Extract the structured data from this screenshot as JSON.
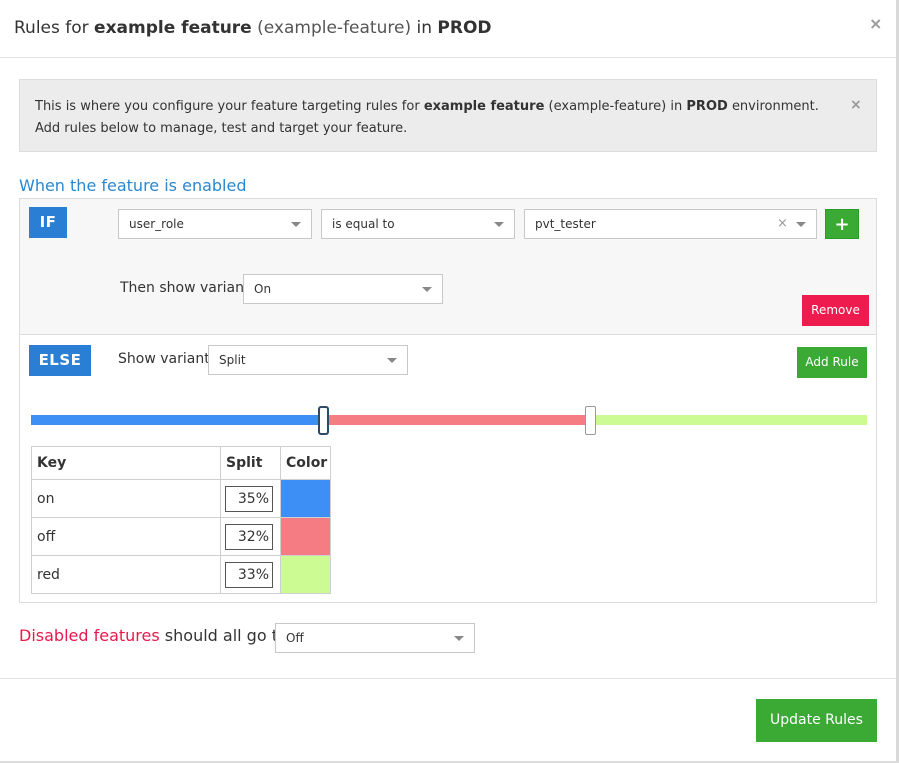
{
  "header": {
    "prefix": "Rules for",
    "feature_name": "example feature",
    "feature_key": "(example-feature)",
    "in_word": "in",
    "environment": "PROD",
    "close_glyph": "×"
  },
  "info": {
    "line1_prefix": "This is where you configure your feature targeting rules for",
    "feature_name": "example feature",
    "feature_key": "(example-feature)",
    "in_word": "in",
    "environment": "PROD",
    "env_suffix": "environment.",
    "line2": "Add rules below to manage, test and target your feature.",
    "close_glyph": "×"
  },
  "section_title": "When the feature is enabled",
  "if_rule": {
    "tag": "IF",
    "attribute": "user_role",
    "operator": "is equal to",
    "value": "pvt_tester",
    "clear_glyph": "×",
    "add_glyph": "+",
    "then_label": "Then show variant",
    "variant": "On",
    "remove_label": "Remove"
  },
  "else_rule": {
    "tag": "ELSE",
    "show_label": "Show variant",
    "variant": "Split",
    "add_rule_label": "Add Rule"
  },
  "split": {
    "headers": {
      "key": "Key",
      "split": "Split",
      "color": "Color"
    },
    "rows": [
      {
        "key": "on",
        "percent": 35,
        "percent_label": "35%",
        "color": "#3d8ff6"
      },
      {
        "key": "off",
        "percent": 32,
        "percent_label": "32%",
        "color": "#f57c82"
      },
      {
        "key": "red",
        "percent": 33,
        "percent_label": "33%",
        "color": "#ccfb93"
      }
    ]
  },
  "disabled": {
    "red_text": "Disabled features",
    "rest_text": "should all go to",
    "variant": "Off"
  },
  "footer": {
    "update_label": "Update Rules"
  }
}
